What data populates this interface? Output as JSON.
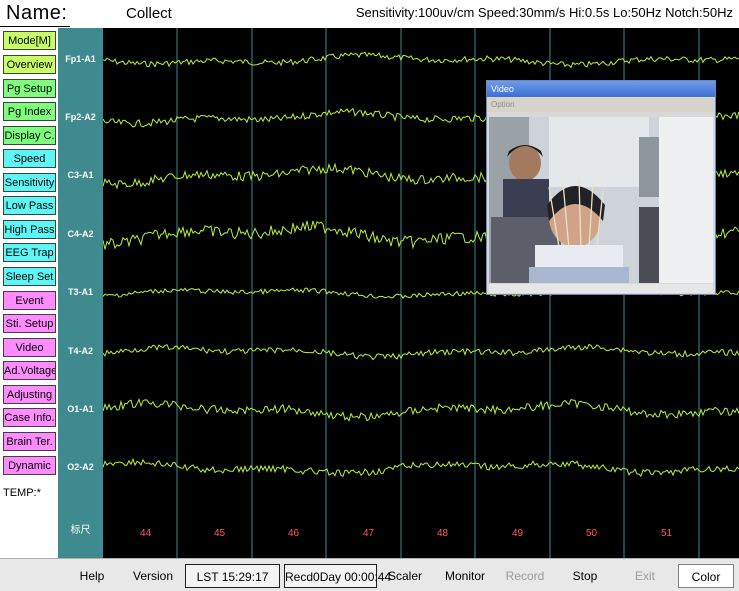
{
  "header": {
    "name_label": "Name:",
    "mode": "Collect",
    "params": "Sensitivity:100uv/cm Speed:30mm/s Hi:0.5s Lo:50Hz Notch:50Hz"
  },
  "sidebar": {
    "buttons": [
      {
        "label": "Mode[M]",
        "color": "#c8ff66"
      },
      {
        "label": "Overview",
        "color": "#c8ff66"
      },
      {
        "label": "Pg Setup",
        "color": "#7dff7d"
      },
      {
        "label": "Pg Index",
        "color": "#7dff7d"
      },
      {
        "label": "Display C.",
        "color": "#7dff7d"
      },
      {
        "label": "Speed",
        "color": "#5cf6f6"
      },
      {
        "label": "Sensitivity",
        "color": "#5cf6f6"
      },
      {
        "label": "Low Pass",
        "color": "#5cf6f6"
      },
      {
        "label": "High Pass",
        "color": "#5cf6f6"
      },
      {
        "label": "EEG Trap",
        "color": "#5cf6f6"
      },
      {
        "label": "Sleep Set",
        "color": "#5cf6f6"
      },
      {
        "label": "Event",
        "color": "#ff8cff"
      },
      {
        "label": "Sti. Setup",
        "color": "#ff8cff"
      },
      {
        "label": "Video",
        "color": "#ff8cff"
      },
      {
        "label": "Ad.Voltage",
        "color": "#ff8cff"
      },
      {
        "label": "Adjusting",
        "color": "#ff8cff"
      },
      {
        "label": "Case Info.",
        "color": "#ff8cff"
      },
      {
        "label": "Brain Ter.",
        "color": "#ff8cff"
      },
      {
        "label": "Dynamic",
        "color": "#ff8cff"
      }
    ],
    "temp_label": "TEMP:*"
  },
  "channels": [
    "Fp1-A1",
    "Fp2-A2",
    "C3-A1",
    "C4-A2",
    "T3-A1",
    "T4-A2",
    "O1-A1",
    "O2-A2"
  ],
  "channel_footer": "标尺",
  "time_ticks": [
    "44",
    "45",
    "46",
    "47",
    "48",
    "49",
    "50",
    "51"
  ],
  "video_window": {
    "title": "Video",
    "menu": "Option"
  },
  "statusbar": {
    "help": "Help",
    "version": "Version",
    "lst": "LST 15:29:17",
    "record": "Recd0Day 00:00:44",
    "scaler": "Scaler",
    "monitor": "Monitor",
    "record_btn": "Record",
    "stop": "Stop",
    "exit": "Exit",
    "color": "Color"
  },
  "colors": {
    "trace": "#b5f23c",
    "grid": "#3f8a8f",
    "tick": "#ff5a5a"
  }
}
